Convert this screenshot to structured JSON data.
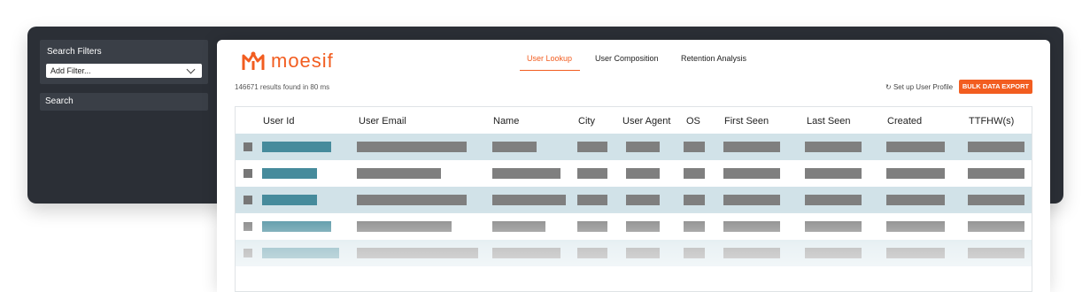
{
  "sidebar": {
    "filters_title": "Search Filters",
    "add_filter_value": "Add Filter...",
    "search_label": "Search"
  },
  "brand": {
    "name": "moesif",
    "color": "#f25d20"
  },
  "tabs": [
    {
      "label": "User Lookup",
      "active": true
    },
    {
      "label": "User Composition",
      "active": false
    },
    {
      "label": "Retention Analysis",
      "active": false
    }
  ],
  "results_text": "146671 results found in 80 ms",
  "setup_link": "Set up User Profile",
  "export_button": "BULK DATA EXPORT",
  "table": {
    "columns": [
      "User Id",
      "User Email",
      "Name",
      "City",
      "User Agent",
      "OS",
      "First Seen",
      "Last Seen",
      "Created",
      "TTFHW(s)"
    ],
    "row_count": 5
  }
}
